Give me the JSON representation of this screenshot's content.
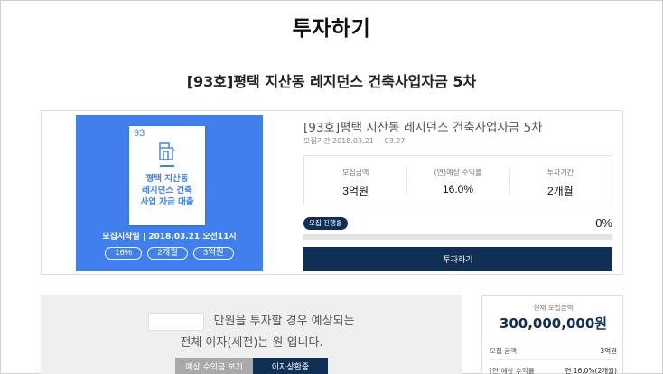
{
  "page": {
    "title": "투자하기"
  },
  "project": {
    "heading": "[93호]평택 지산동 레지던스 건축사업자금 5차",
    "title": "[93호]평택 지산동 레지던스 건축사업자금 5차",
    "period": "모집기간 2018.03.21 ~ 03.27",
    "thumbnail": {
      "number": "93",
      "name_lines": [
        "평택 지산동",
        "레지던스 건축",
        "사업 자금 대출"
      ],
      "start_text": "모집시작일 | 2018.03.21 오전11시",
      "pills": [
        "16%",
        "2개월",
        "3억원"
      ],
      "bg_color": "#3f80ee",
      "icon": "building-icon"
    },
    "stats": [
      {
        "label": "모집금액",
        "value": "3억원"
      },
      {
        "label": "(연)예상 수익률",
        "value": "16.0%"
      },
      {
        "label": "투자기간",
        "value": "2개월"
      }
    ],
    "status_badge": "모집 진행률",
    "progress_label": "0%",
    "progress_fraction": 0,
    "invest_button": "투자하기"
  },
  "calculator": {
    "amount_value": "",
    "line1_suffix": "만원을 투자할 경우 예상되는",
    "line2": "전체 이자(세전)는 원 입니다.",
    "btn_expected_return": "예상 수익금 보기",
    "btn_interest_schedule": "이자상환중"
  },
  "summary": {
    "current_label": "현재 모집금액",
    "current_amount": "300,000,000원",
    "rows": [
      {
        "label": "모집 금액",
        "value": "3억원"
      },
      {
        "label": "(연)예상 수익률",
        "value": "연 16.0%(2개월)"
      }
    ]
  },
  "colors": {
    "navy": "#0f2f55",
    "blue": "#3f80ee",
    "gray_button": "#a9a9a9"
  }
}
